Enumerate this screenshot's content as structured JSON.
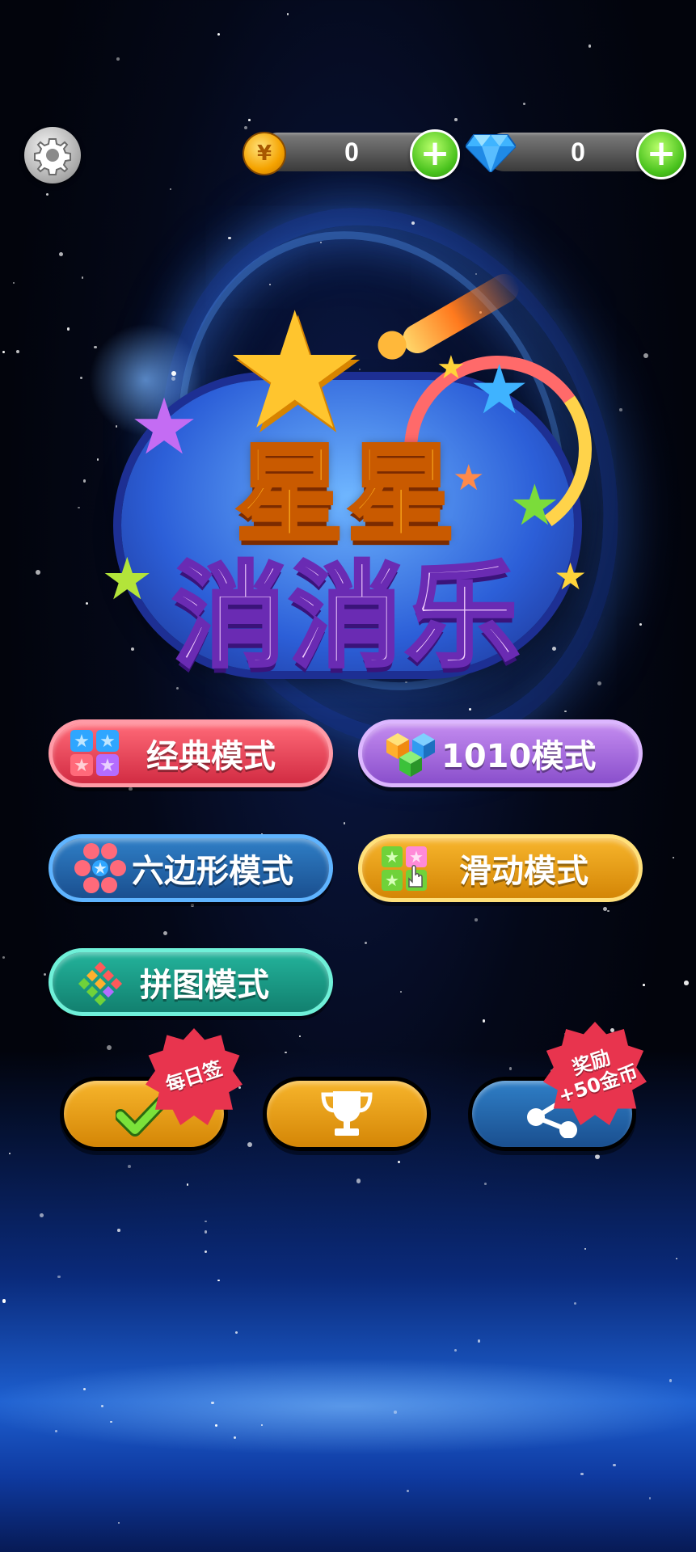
{
  "currencies": {
    "coins": {
      "icon": "coin-icon",
      "value": "0",
      "add_icon": "plus-icon"
    },
    "gems": {
      "icon": "diamond-icon",
      "value": "0",
      "add_icon": "plus-icon"
    }
  },
  "settings": {
    "icon": "gear-icon"
  },
  "logo": {
    "line1": "星星",
    "line2": "消消乐"
  },
  "modes": [
    {
      "label": "经典模式",
      "icon": "star-blocks-icon",
      "color": "#d22c43"
    },
    {
      "label": "1010模式",
      "icon": "cubes-icon",
      "color": "#8a4fcc"
    },
    {
      "label": "六边形模式",
      "icon": "hexagon-stars-icon",
      "color": "#1a4f8f"
    },
    {
      "label": "滑动模式",
      "icon": "swipe-tiles-icon",
      "color": "#d48606"
    },
    {
      "label": "拼图模式",
      "icon": "puzzle-blocks-icon",
      "color": "#12806f"
    }
  ],
  "actions": {
    "daily_checkin": {
      "icon": "checkmark-icon",
      "badge": "每日签"
    },
    "leaderboard": {
      "icon": "trophy-icon"
    },
    "share": {
      "icon": "share-icon",
      "badge_line1": "奖励",
      "badge_line2": "+50金币"
    }
  }
}
